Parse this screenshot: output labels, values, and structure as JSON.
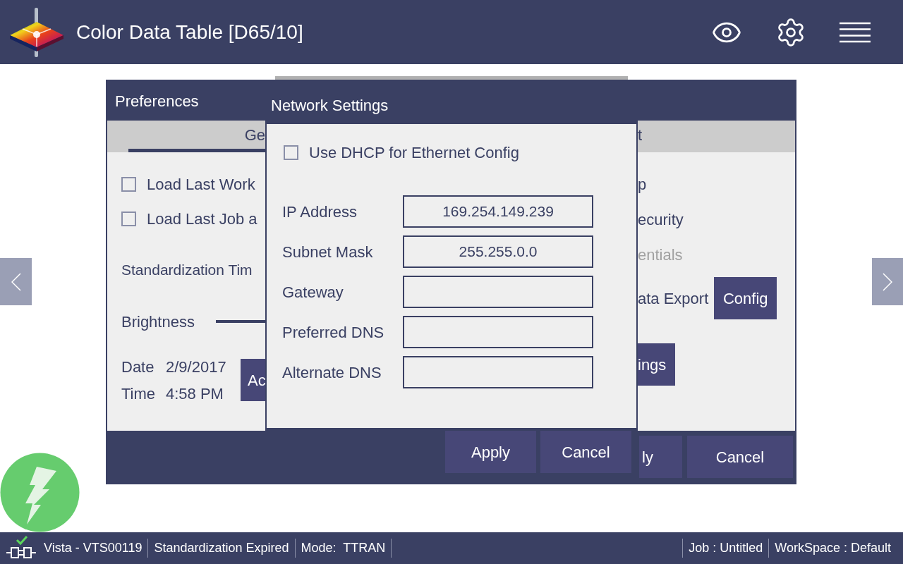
{
  "header": {
    "title": "Color Data Table [D65/10]"
  },
  "preferences": {
    "title": "Preferences",
    "tabs": [
      {
        "label": "Ge",
        "selected": true
      },
      {
        "label": "t",
        "selected": false
      }
    ],
    "options": [
      {
        "label": "Load Last Work",
        "checked": false
      },
      {
        "label": "Load Last Job a",
        "checked": false
      }
    ],
    "standardization_label": "Standardization Tim",
    "brightness_label": "Brightness",
    "date": {
      "label": "Date",
      "value": "2/9/2017"
    },
    "time": {
      "label": "Time",
      "value": "4:58 PM"
    },
    "adjust_button": "Ac",
    "right_items": [
      {
        "label": "p",
        "disabled": false
      },
      {
        "label": "ecurity",
        "disabled": false
      },
      {
        "label": "entials",
        "disabled": true
      }
    ],
    "data_export": {
      "label": "ata Export",
      "button": "Config"
    },
    "settings_button": "ings",
    "buttons": [
      "ly",
      "Cancel"
    ]
  },
  "network": {
    "title": "Network Settings",
    "dhcp": {
      "label": "Use DHCP for Ethernet Config",
      "checked": false
    },
    "fields": [
      {
        "label": "IP Address",
        "value": "169.254.149.239"
      },
      {
        "label": "Subnet Mask",
        "value": "255.255.0.0"
      },
      {
        "label": "Gateway"
      },
      {
        "label": "Preferred DNS"
      },
      {
        "label": "Alternate DNS"
      }
    ],
    "buttons": [
      "Apply",
      "Cancel"
    ]
  },
  "status_bar": {
    "left": [
      "Vista - VTS00119",
      "Standardization Expired",
      "Mode:  TTRAN"
    ],
    "right": [
      "Job : Untitled",
      "WorkSpace : Default"
    ]
  }
}
